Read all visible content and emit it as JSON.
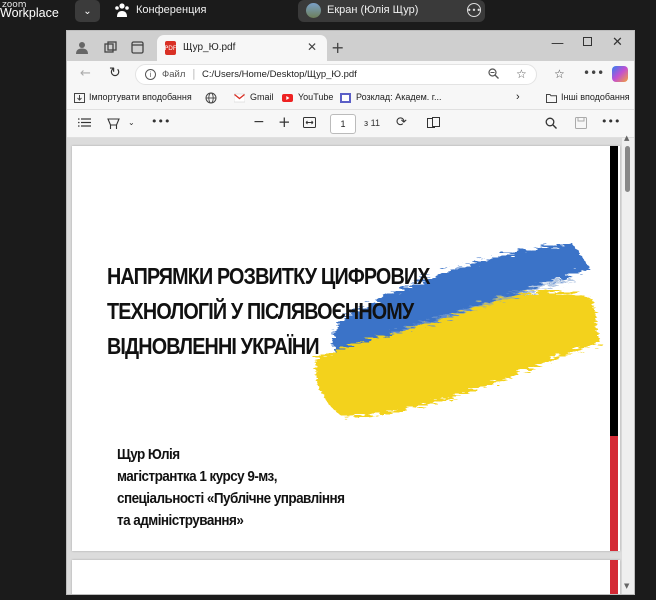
{
  "zoom": {
    "logo_line1": "zoom",
    "logo_line2": "Workplace",
    "meeting_label": "Конференция",
    "share_label": "Екран (Юлія Щур)"
  },
  "browser": {
    "tab_title": "Щур_Ю.pdf",
    "url_scheme": "Файл",
    "url": "C:/Users/Home/Desktop/Щур_Ю.pdf",
    "bookmarks": {
      "import": "Імпортувати вподобання",
      "gmail": "Gmail",
      "youtube": "YouTube",
      "rozklad": "Розклад: Академ. г...",
      "other": "Інші вподобання"
    },
    "pdf_toolbar": {
      "page_number": "1",
      "page_count": "з 11",
      "zoom_out": "−",
      "zoom_in": "+"
    }
  },
  "slide": {
    "title_lines": [
      "НАПРЯМКИ РОЗВИТКУ ЦИФРОВИХ",
      "ТЕХНОЛОГІЙ У ПІСЛЯВОЄННОМУ",
      "ВІДНОВЛЕННІ УКРАЇНИ"
    ],
    "author_lines": [
      "Щур Юлія",
      "магістрантка 1 курсу 9-мз,",
      "спеціальності «Публічне управління",
      "та адміністрування»"
    ]
  },
  "colors": {
    "flag_blue": "#3a73c8",
    "flag_yellow": "#f3d21a",
    "accent_red": "#d42a35"
  }
}
